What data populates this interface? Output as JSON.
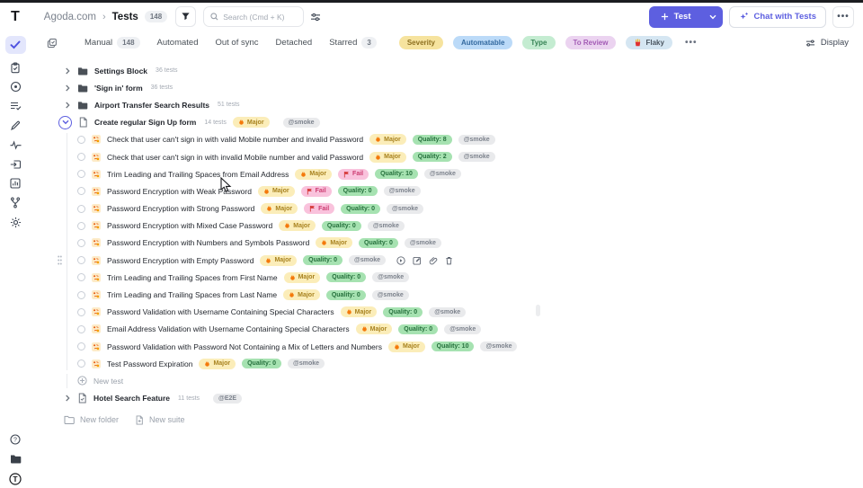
{
  "topbar": {
    "logo_letter": "T",
    "breadcrumb": {
      "project": "Agoda.com",
      "separator": "›",
      "current": "Tests",
      "count": "148"
    },
    "search_placeholder": "Search (Cmd + K)",
    "new_test_label": "Test",
    "chat_label": "Chat with Tests",
    "more_label": "•••"
  },
  "filterbar": {
    "tabs": [
      {
        "label": "Manual",
        "count": "148"
      },
      {
        "label": "Automated"
      },
      {
        "label": "Out of sync"
      },
      {
        "label": "Detached"
      },
      {
        "label": "Starred",
        "count": "3"
      }
    ],
    "pills": [
      {
        "label": "Severity"
      },
      {
        "label": "Automatable"
      },
      {
        "label": "Type"
      },
      {
        "label": "To Review"
      },
      {
        "label": "Flaky"
      }
    ],
    "more_label": "•••",
    "display_label": "Display"
  },
  "tree": {
    "suites": [
      {
        "name": "Settings Block",
        "count": "36 tests"
      },
      {
        "name": "'Sign in' form",
        "count": "36 tests"
      },
      {
        "name": "Airport Transfer Search Results",
        "count": "51 tests"
      }
    ],
    "expanded_suite": {
      "name": "Create regular Sign Up form",
      "count": "14 tests",
      "severity": "Major",
      "tag": "@smoke"
    },
    "tests": [
      {
        "title": "Check that user can't sign in with valid Mobile number and invalid Password",
        "severity": "Major",
        "quality": "Quality: 8",
        "tag": "@smoke"
      },
      {
        "title": "Check that user can't sign in with invalid Mobile number and valid Password",
        "severity": "Major",
        "quality": "Quality: 2",
        "tag": "@smoke"
      },
      {
        "title": "Trim Leading and Trailing Spaces from Email Address",
        "severity": "Major",
        "fail": "Fail",
        "quality": "Quality: 10",
        "tag": "@smoke"
      },
      {
        "title": "Password Encryption with Weak Password",
        "severity": "Major",
        "fail": "Fail",
        "quality": "Quality: 0",
        "tag": "@smoke"
      },
      {
        "title": "Password Encryption with Strong Password",
        "severity": "Major",
        "fail": "Fail",
        "quality": "Quality: 0",
        "tag": "@smoke"
      },
      {
        "title": "Password Encryption with Mixed Case Password",
        "severity": "Major",
        "quality": "Quality: 0",
        "tag": "@smoke"
      },
      {
        "title": "Password Encryption with Numbers and Symbols Password",
        "severity": "Major",
        "quality": "Quality: 0",
        "tag": "@smoke"
      },
      {
        "title": "Password Encryption with Empty Password",
        "severity": "Major",
        "quality": "Quality: 0",
        "tag": "@smoke",
        "hover_actions": true
      },
      {
        "title": "Trim Leading and Trailing Spaces from First Name",
        "severity": "Major",
        "quality": "Quality: 0",
        "tag": "@smoke"
      },
      {
        "title": "Trim Leading and Trailing Spaces from Last Name",
        "severity": "Major",
        "quality": "Quality: 0",
        "tag": "@smoke"
      },
      {
        "title": "Password Validation with Username Containing Special Characters",
        "severity": "Major",
        "quality": "Quality: 0",
        "tag": "@smoke"
      },
      {
        "title": "Email Address Validation with Username Containing Special Characters",
        "severity": "Major",
        "quality": "Quality: 0",
        "tag": "@smoke"
      },
      {
        "title": "Password Validation with Password Not Containing a Mix of Letters and Numbers",
        "severity": "Major",
        "quality": "Quality: 10",
        "tag": "@smoke"
      },
      {
        "title": "Test Password Expiration",
        "severity": "Major",
        "quality": "Quality: 0",
        "tag": "@smoke"
      }
    ],
    "new_test_label": "New test",
    "collapsed_suite": {
      "name": "Hotel Search Feature",
      "count": "11 tests",
      "tag": "@E2E"
    },
    "footer": {
      "new_folder": "New folder",
      "new_suite": "New suite"
    }
  },
  "colors": {
    "accent": "#5D5FE0",
    "severity_bg": "#FBEDB9",
    "fail_bg": "#F9C2DC",
    "quality_bg": "#A6E2B1",
    "tag_bg": "#E9EAEC"
  },
  "icons": {
    "severity": "flame",
    "fail": "flag",
    "flaky": "fries",
    "test_type": "manual-test"
  }
}
